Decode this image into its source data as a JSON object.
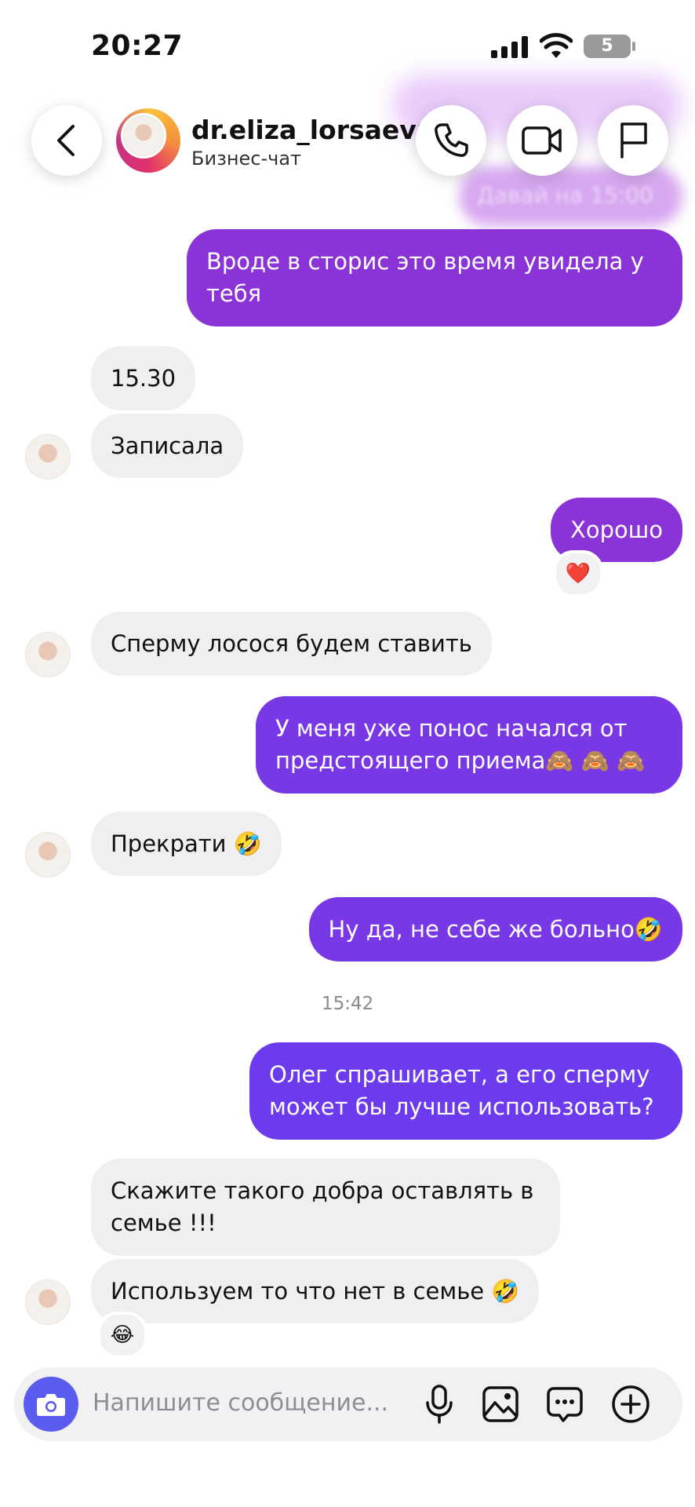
{
  "status_bar": {
    "time": "20:27",
    "battery": "5"
  },
  "header": {
    "name": "dr.eliza_lorsaeva",
    "subtitle": "Бизнес-чат",
    "partial_message": "Давай на 15:00"
  },
  "messages": [
    {
      "dir": "out",
      "text": "Вроде в сторис это время увидела у тебя"
    },
    {
      "dir": "in",
      "text": "15.30"
    },
    {
      "dir": "in",
      "text": "Записала"
    },
    {
      "dir": "out",
      "text": "Хорошо",
      "reaction": "❤️"
    },
    {
      "dir": "in",
      "text": "Сперму лосося будем ставить"
    },
    {
      "dir": "out",
      "text": "У меня уже понос начался от предстоящего приема🙈 🙈 🙈"
    },
    {
      "dir": "in",
      "text": "Прекрати 🤣"
    },
    {
      "dir": "out",
      "text": "Ну да, не себе же больно🤣"
    },
    {
      "dir": "out",
      "text": "Олег спрашивает, а его сперму может бы лучше использовать?"
    },
    {
      "dir": "in",
      "text": "Скажите такого добра оставлять в семье !!!"
    },
    {
      "dir": "in",
      "text": "Используем то что нет в семье 🤣",
      "reaction": "😂"
    }
  ],
  "timestamp": "15:42",
  "composer": {
    "placeholder": "Напишите сообщение..."
  },
  "icons": [
    "back-icon",
    "phone-icon",
    "video-icon",
    "flag-icon",
    "camera-icon",
    "microphone-icon",
    "image-icon",
    "sticker-icon",
    "plus-icon"
  ],
  "colors": {
    "outgoing_purple": "#8a34d8",
    "outgoing_violet": "#6c3bee",
    "incoming_gray": "#efeff2",
    "camera_blue": "#5a5cf0"
  }
}
